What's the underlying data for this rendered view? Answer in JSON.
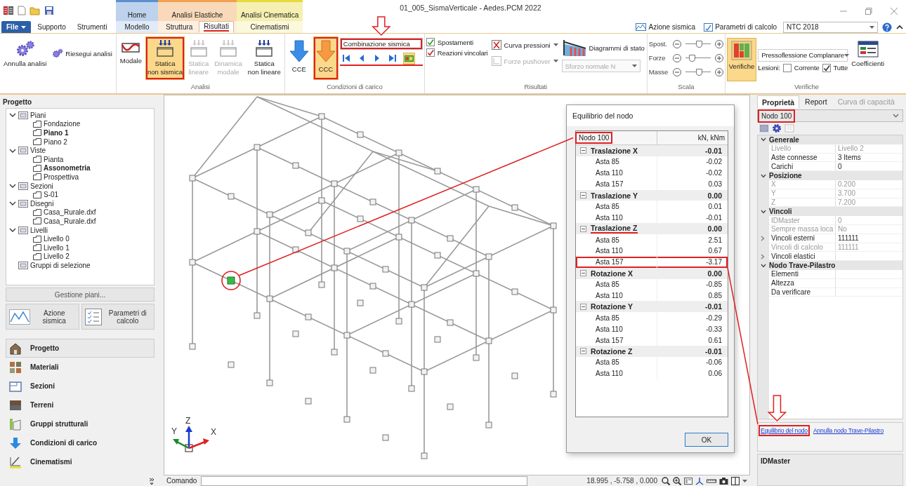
{
  "window": {
    "title": "01_005_SismaVerticale - Aedes.PCM 2022"
  },
  "app_tabs": [
    {
      "label": "File",
      "kind": "file",
      "selected": false,
      "underlined": false
    },
    {
      "label": "Supporto",
      "kind": "plain",
      "selected": false,
      "underlined": false
    },
    {
      "label": "Strumenti",
      "kind": "plain",
      "selected": false,
      "underlined": false
    }
  ],
  "context_groups": [
    {
      "label": "Home",
      "color": "#5b8fd0",
      "tabs": [
        {
          "label": "Modello",
          "selected": false,
          "underlined": false
        }
      ]
    },
    {
      "label": "Analisi Elastiche",
      "color": "#f0a050",
      "tabs": [
        {
          "label": "Struttura",
          "selected": false,
          "underlined": false
        },
        {
          "label": "Risultati",
          "selected": true,
          "underlined": true
        }
      ]
    },
    {
      "label": "Analisi Cinematica",
      "color": "#e6da3c",
      "tabs": [
        {
          "label": "Cinematismi",
          "selected": false,
          "underlined": false
        }
      ]
    }
  ],
  "quick_links": [
    {
      "label": "Azione sismica"
    },
    {
      "label": "Parametri di calcolo"
    }
  ],
  "norm_select": {
    "value": "NTC 2018"
  },
  "ribbon_groups": [
    {
      "items": [
        {
          "kind": "large",
          "label": "Annulla analisi",
          "selected": false,
          "disabled": false,
          "highlighted": false
        },
        {
          "kind": "small",
          "label": "Riesegui analisi",
          "selected": false,
          "disabled": false,
          "highlighted": false
        }
      ]
    },
    {
      "title": "Analisi",
      "items": [
        {
          "kind": "large",
          "label": "Modale",
          "selected": false,
          "disabled": false,
          "highlighted": false
        },
        {
          "kind": "large",
          "label": "Statica\nnon sismica",
          "selected": true,
          "disabled": false,
          "highlighted": true
        },
        {
          "kind": "large",
          "label": "Statica\nlineare",
          "selected": false,
          "disabled": true,
          "highlighted": false
        },
        {
          "kind": "large",
          "label": "Dinamica\nmodale",
          "selected": false,
          "disabled": true,
          "highlighted": false
        },
        {
          "kind": "large",
          "label": "Statica\nnon lineare",
          "selected": false,
          "disabled": false,
          "highlighted": false
        }
      ]
    },
    {
      "title": "Condizioni di carico",
      "items": [
        {
          "kind": "large",
          "label": "CCE",
          "selected": false,
          "disabled": false,
          "highlighted": false
        },
        {
          "kind": "large",
          "label": "CCC",
          "selected": true,
          "disabled": false,
          "highlighted": true
        },
        {
          "kind": "column",
          "items": [
            {
              "kind": "field",
              "value": "Combinazione sismica",
              "highlighted": true
            },
            {
              "kind": "nav",
              "underlined": true,
              "toggle_on": true
            }
          ]
        }
      ]
    },
    {
      "title": "Risultati",
      "items": [
        {
          "kind": "column",
          "items": [
            {
              "kind": "check",
              "label": "Spostamenti",
              "checked": true
            },
            {
              "kind": "check",
              "label": "Reazioni vincolari",
              "checked": true
            }
          ]
        },
        {
          "kind": "column",
          "items": [
            {
              "kind": "dropdown",
              "label": "Curva pressioni",
              "disabled": false
            },
            {
              "kind": "dropdown",
              "label": "Forze pushover",
              "disabled": true
            }
          ]
        },
        {
          "kind": "column",
          "items": [
            {
              "kind": "gallery",
              "label": "Diagrammi di stato"
            },
            {
              "kind": "select",
              "value": "Sforzo normale N",
              "disabled": true
            }
          ]
        }
      ]
    },
    {
      "title": "Scala",
      "items": [
        {
          "kind": "column",
          "items": [
            {
              "kind": "slider",
              "label": "Spost.",
              "level": 0.55
            },
            {
              "kind": "slider",
              "label": "Forze",
              "level": 0.2
            },
            {
              "kind": "slider",
              "label": "Masse",
              "level": 0.55
            }
          ]
        }
      ]
    },
    {
      "title": "Verifiche",
      "items": [
        {
          "kind": "large",
          "label": "Verifiche",
          "selected": true,
          "disabled": false,
          "highlighted": false
        },
        {
          "kind": "column",
          "items": [
            {
              "kind": "select",
              "value": "Pressoflessione Complanare",
              "disabled": false
            },
            {
              "kind": "row",
              "items": [
                {
                  "kind": "label",
                  "label": "Lesioni:"
                },
                {
                  "kind": "check",
                  "label": "Corrente",
                  "checked": false
                },
                {
                  "kind": "check",
                  "label": "Tutte",
                  "checked": true
                }
              ]
            }
          ]
        },
        {
          "kind": "large",
          "label": "Coefficienti",
          "selected": false,
          "disabled": false,
          "highlighted": false
        }
      ]
    }
  ],
  "project_panel": {
    "title": "Progetto",
    "tree": [
      {
        "label": "Piani",
        "expanded": true,
        "active": false,
        "children": [
          {
            "label": "Fondazione",
            "active": false
          },
          {
            "label": "Piano 1",
            "active": true
          },
          {
            "label": "Piano 2",
            "active": false
          }
        ]
      },
      {
        "label": "Viste",
        "expanded": true,
        "active": false,
        "children": [
          {
            "label": "Pianta",
            "active": false
          },
          {
            "label": "Assonometria",
            "active": true
          },
          {
            "label": "Prospettiva",
            "active": false
          }
        ]
      },
      {
        "label": "Sezioni",
        "expanded": true,
        "active": false,
        "children": [
          {
            "label": "S-01",
            "active": false
          }
        ]
      },
      {
        "label": "Disegni",
        "expanded": true,
        "active": false,
        "children": [
          {
            "label": "Casa_Rurale.dxf",
            "active": false
          },
          {
            "label": "Casa_Rurale.dxf",
            "active": false
          }
        ]
      },
      {
        "label": "Livelli",
        "expanded": true,
        "active": false,
        "children": [
          {
            "label": "Livello 0",
            "active": false
          },
          {
            "label": "Livello 1",
            "active": false
          },
          {
            "label": "Livello 2",
            "active": false
          }
        ]
      },
      {
        "label": "Gruppi di selezione",
        "active": false
      }
    ],
    "manage_button": "Gestione piani...",
    "shortcut_buttons": [
      {
        "label": "Azione sismica"
      },
      {
        "label": "Parametri di calcolo"
      }
    ],
    "sections": [
      {
        "label": "Progetto",
        "selected": true
      },
      {
        "label": "Materiali",
        "selected": false
      },
      {
        "label": "Sezioni",
        "selected": false
      },
      {
        "label": "Terreni",
        "selected": false
      },
      {
        "label": "Gruppi strutturali",
        "selected": false
      },
      {
        "label": "Condizioni di carico",
        "selected": false
      },
      {
        "label": "Cinematismi",
        "selected": false
      }
    ]
  },
  "viewport": {
    "axes": [
      "Z",
      "Y",
      "X"
    ],
    "command_label": "Comando",
    "coordinates": "18.995 , -5.758 , 0.000"
  },
  "dialog": {
    "title": "Equilibrio del nodo",
    "columns": [
      {
        "label": "Nodo 100",
        "highlighted": true
      },
      {
        "label": "kN, kNm",
        "highlighted": false
      }
    ],
    "groups": [
      {
        "label": "Traslazione X",
        "value": "-0.01",
        "expanded": true,
        "underlined": false,
        "rows": [
          {
            "label": "Asta 85",
            "value": "-0.02",
            "highlighted": false
          },
          {
            "label": "Asta 110",
            "value": "-0.02",
            "highlighted": false
          },
          {
            "label": "Asta 157",
            "value": "0.03",
            "highlighted": false
          }
        ]
      },
      {
        "label": "Traslazione Y",
        "value": "0.00",
        "expanded": true,
        "underlined": false,
        "rows": [
          {
            "label": "Asta 85",
            "value": "0.01",
            "highlighted": false
          },
          {
            "label": "Asta 110",
            "value": "-0.01",
            "highlighted": false
          }
        ]
      },
      {
        "label": "Traslazione Z",
        "value": "0.00",
        "expanded": true,
        "underlined": true,
        "rows": [
          {
            "label": "Asta 85",
            "value": "2.51",
            "highlighted": false
          },
          {
            "label": "Asta 110",
            "value": "0.67",
            "highlighted": false
          },
          {
            "label": "Asta 157",
            "value": "-3.17",
            "highlighted": true
          }
        ]
      },
      {
        "label": "Rotazione X",
        "value": "0.00",
        "expanded": true,
        "underlined": false,
        "rows": [
          {
            "label": "Asta 85",
            "value": "-0.85",
            "highlighted": false
          },
          {
            "label": "Asta 110",
            "value": "0.85",
            "highlighted": false
          }
        ]
      },
      {
        "label": "Rotazione Y",
        "value": "-0.01",
        "expanded": true,
        "underlined": false,
        "rows": [
          {
            "label": "Asta 85",
            "value": "-0.29",
            "highlighted": false
          },
          {
            "label": "Asta 110",
            "value": "-0.33",
            "highlighted": false
          },
          {
            "label": "Asta 157",
            "value": "0.61",
            "highlighted": false
          }
        ]
      },
      {
        "label": "Rotazione Z",
        "value": "-0.01",
        "expanded": true,
        "underlined": false,
        "rows": [
          {
            "label": "Asta 85",
            "value": "-0.06",
            "highlighted": false
          },
          {
            "label": "Asta 110",
            "value": "0.06",
            "highlighted": false
          }
        ]
      }
    ],
    "ok_button": "OK"
  },
  "properties_panel": {
    "tabs": [
      {
        "label": "Proprietà",
        "selected": true,
        "disabled": false
      },
      {
        "label": "Report",
        "selected": false,
        "disabled": false
      },
      {
        "label": "Curva di capacità",
        "selected": false,
        "disabled": true
      }
    ],
    "object_select": {
      "value": "Nodo 100",
      "highlighted": true
    },
    "categories": [
      {
        "label": "Generale",
        "expanded": true,
        "rows": [
          {
            "name": "Livello",
            "value": "Livello 2",
            "readonly": true,
            "expandable": false
          },
          {
            "name": "Aste connesse",
            "value": "3 Items",
            "readonly": false,
            "expandable": false
          },
          {
            "name": "Carichi",
            "value": "0",
            "readonly": false,
            "expandable": false
          }
        ]
      },
      {
        "label": "Posizione",
        "expanded": true,
        "rows": [
          {
            "name": "X",
            "value": "0.200",
            "readonly": true,
            "expandable": false
          },
          {
            "name": "Y",
            "value": "3.700",
            "readonly": true,
            "expandable": false
          },
          {
            "name": "Z",
            "value": "7.200",
            "readonly": true,
            "expandable": false
          }
        ]
      },
      {
        "label": "Vincoli",
        "expanded": true,
        "rows": [
          {
            "name": "IDMaster",
            "value": "0",
            "readonly": true,
            "expandable": false
          },
          {
            "name": "Sempre massa loca",
            "value": "No",
            "readonly": true,
            "expandable": false
          },
          {
            "name": "Vincoli esterni",
            "value": "111111",
            "readonly": false,
            "expandable": true
          },
          {
            "name": "Vincoli di calcolo",
            "value": "111111",
            "readonly": true,
            "expandable": false
          },
          {
            "name": "Vincoli elastici",
            "readonly": false,
            "expandable": true
          }
        ]
      },
      {
        "label": "Nodo Trave-Pilastro",
        "expanded": true,
        "rows": [
          {
            "name": "Elementi",
            "readonly": false,
            "expandable": false
          },
          {
            "name": "Altezza",
            "readonly": false,
            "expandable": false
          },
          {
            "name": "Da verificare",
            "readonly": false,
            "expandable": false
          }
        ]
      }
    ],
    "links": [
      {
        "label": "Equilibrio del nodo",
        "highlighted": true
      },
      {
        "label": "Annulla nodo Trave-Pilastro",
        "highlighted": false
      }
    ],
    "description": {
      "title": "IDMaster"
    }
  }
}
